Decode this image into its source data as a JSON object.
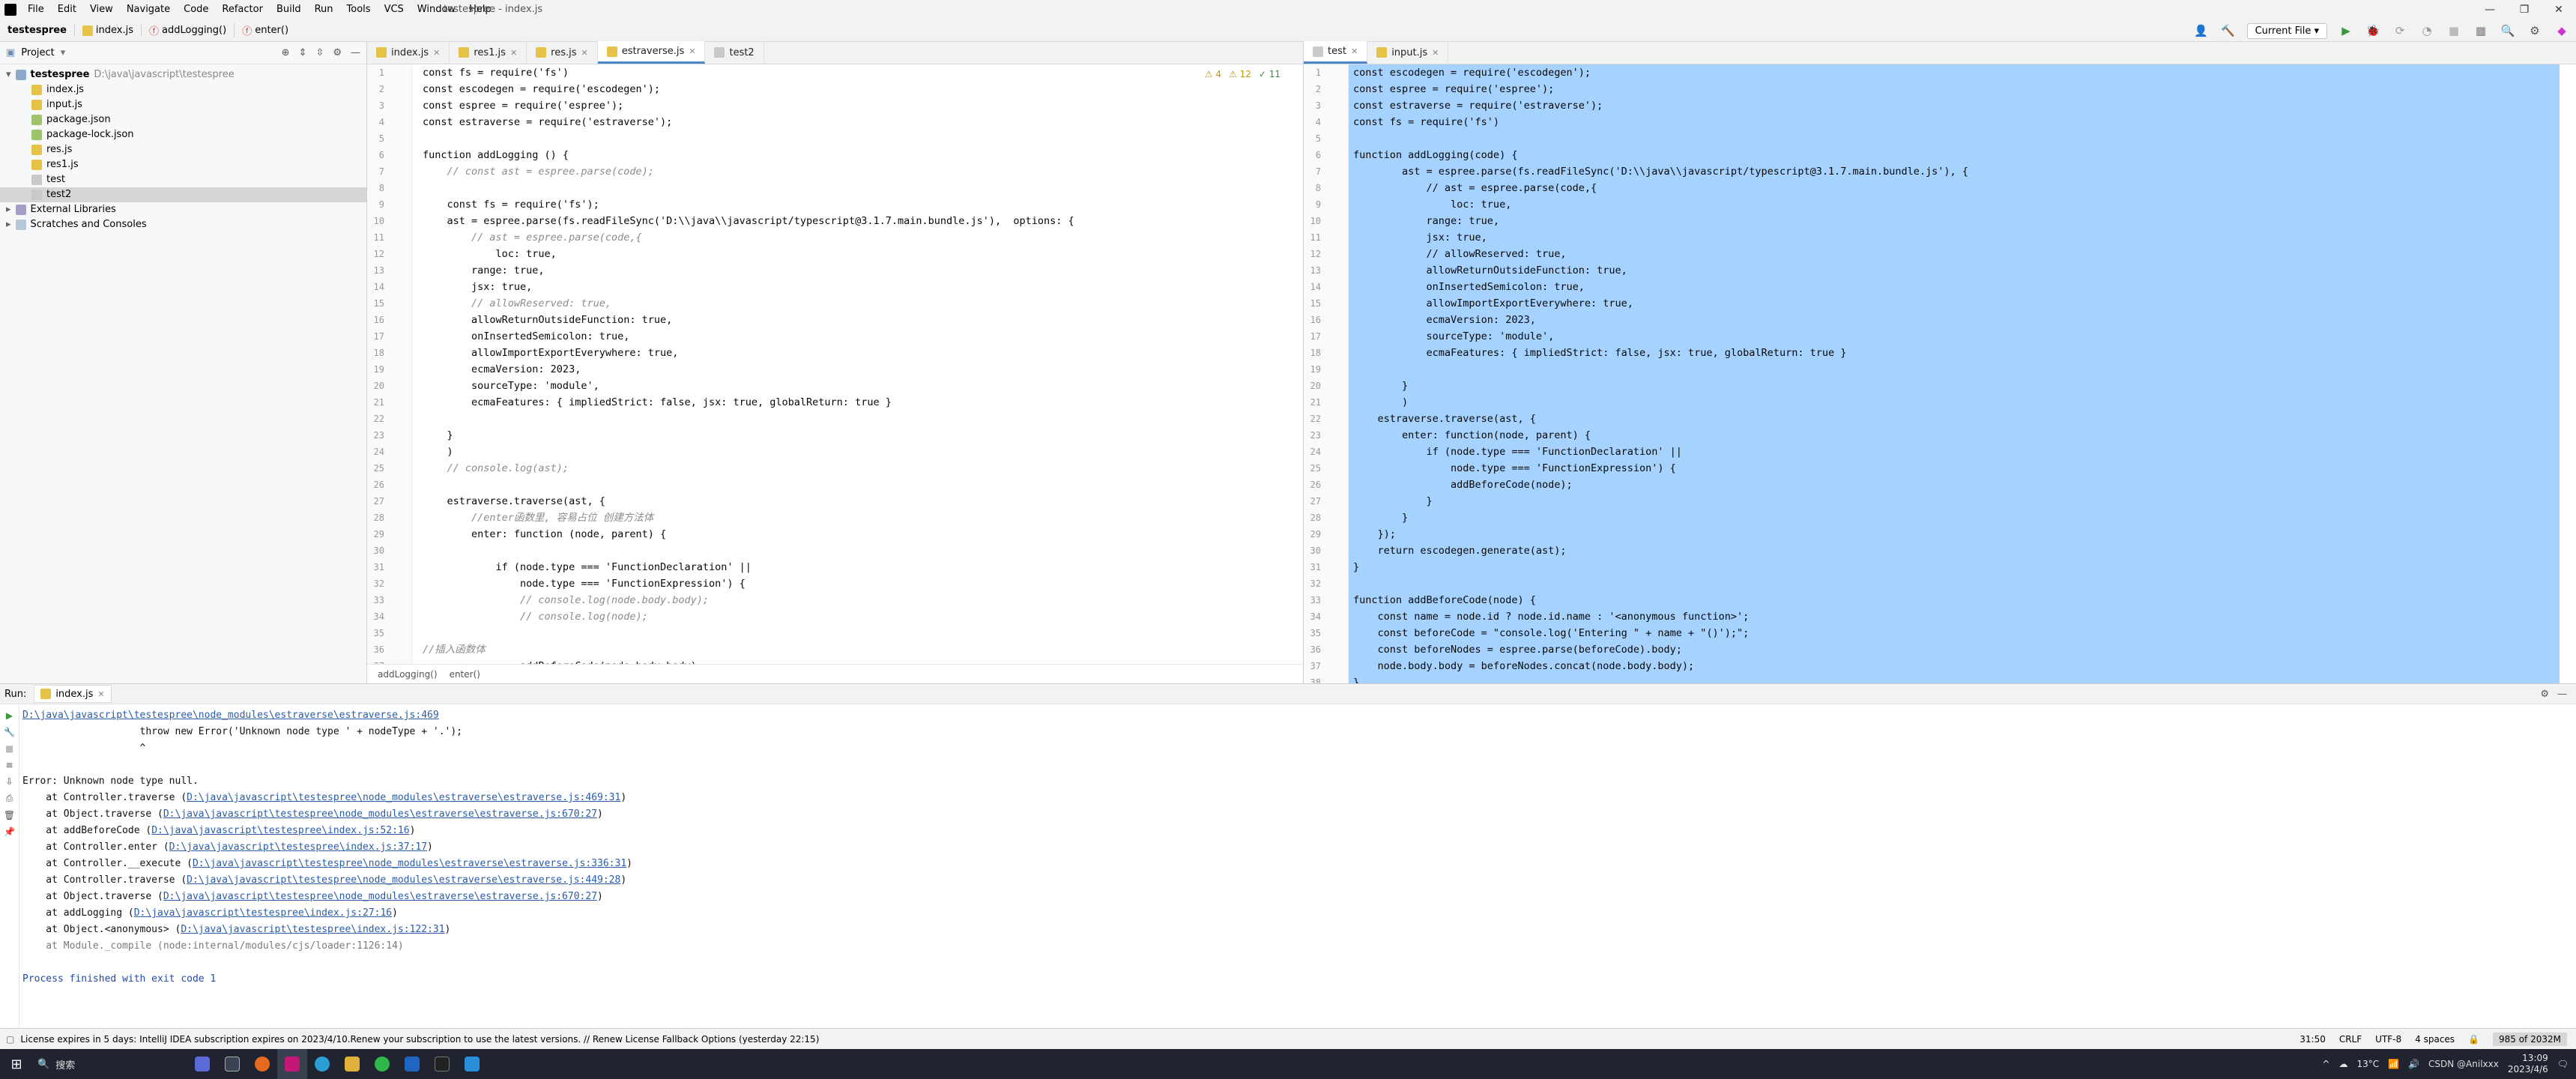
{
  "titlebar": {
    "menus": [
      "File",
      "Edit",
      "View",
      "Navigate",
      "Code",
      "Refactor",
      "Build",
      "Run",
      "Tools",
      "VCS",
      "Window",
      "Help"
    ],
    "title": "testespree - index.js",
    "win_controls": [
      "—",
      "❐",
      "✕"
    ]
  },
  "navbar": {
    "project": "testespree",
    "file": "index.js",
    "func1": "addLogging()",
    "func2": "enter()",
    "run_config": "Current File"
  },
  "project_panel": {
    "title": "Project",
    "root": "testespree",
    "root_path": "D:\\java\\javascript\\testespree",
    "files": [
      "index.js",
      "input.js",
      "package.json",
      "package-lock.json",
      "res.js",
      "res1.js",
      "test",
      "test2"
    ],
    "selected": "test2",
    "extras": [
      "External Libraries",
      "Scratches and Consoles"
    ]
  },
  "editor": {
    "tabs": [
      "index.js",
      "res1.js",
      "res.js",
      "estraverse.js",
      "test2"
    ],
    "active_tab": "estraverse.js",
    "inspections": {
      "warnings": "4",
      "weak": "12",
      "ok": "11"
    },
    "line_numbers": [
      "1",
      "2",
      "3",
      "4",
      "5",
      "6",
      "7",
      "8",
      "9",
      "10",
      "11",
      "12",
      "13",
      "14",
      "15",
      "16",
      "17",
      "18",
      "19",
      "20",
      "21",
      "22",
      "23",
      "24",
      "25",
      "26",
      "27",
      "28",
      "29",
      "30",
      "31",
      "32",
      "33",
      "34",
      "35",
      "36",
      "37"
    ],
    "lines": [
      "const fs = require('fs')",
      "const escodegen = require('escodegen');",
      "const espree = require('espree');",
      "const estraverse = require('estraverse');",
      "",
      "function addLogging () {",
      "    // const ast = espree.parse(code);",
      "",
      "    const fs = require('fs');",
      "    ast = espree.parse(fs.readFileSync('D:\\\\java\\\\javascript/typescript@3.1.7.main.bundle.js'),  options: {",
      "        // ast = espree.parse(code,{",
      "            loc: true,",
      "        range: true,",
      "        jsx: true,",
      "        // allowReserved: true,",
      "        allowReturnOutsideFunction: true,",
      "        onInsertedSemicolon: true,",
      "        allowImportExportEverywhere: true,",
      "        ecmaVersion: 2023,",
      "        sourceType: 'module',",
      "        ecmaFeatures: { impliedStrict: false, jsx: true, globalReturn: true }",
      "",
      "    }",
      "    )",
      "    // console.log(ast);",
      "",
      "    estraverse.traverse(ast, {",
      "        //enter函数里, 容易占位 创建方法体",
      "        enter: function (node, parent) {",
      "",
      "            if (node.type === 'FunctionDeclaration' ||",
      "                node.type === 'FunctionExpression') {",
      "                // console.log(node.body.body);",
      "                // console.log(node);",
      "",
      "//插入函数体",
      "                addBeforeCode(node.body.body);"
    ],
    "breadcrumbs": [
      "addLogging()",
      "enter()"
    ]
  },
  "editor2": {
    "tabs": [
      "test",
      "input.js"
    ],
    "active_tab": "test",
    "line_numbers": [
      "1",
      "2",
      "3",
      "4",
      "5",
      "6",
      "7",
      "8",
      "9",
      "10",
      "11",
      "12",
      "13",
      "14",
      "15",
      "16",
      "17",
      "18",
      "19",
      "20",
      "21",
      "22",
      "23",
      "24",
      "25",
      "26",
      "27",
      "28",
      "29",
      "30",
      "31",
      "32",
      "33",
      "34",
      "35",
      "36",
      "37",
      "38"
    ],
    "lines": [
      "const escodegen = require('escodegen');",
      "const espree = require('espree');",
      "const estraverse = require('estraverse');",
      "const fs = require('fs')",
      "",
      "function addLogging(code) {",
      "        ast = espree.parse(fs.readFileSync('D:\\\\java\\\\javascript/typescript@3.1.7.main.bundle.js'), {",
      "            // ast = espree.parse(code,{",
      "                loc: true,",
      "            range: true,",
      "            jsx: true,",
      "            // allowReserved: true,",
      "            allowReturnOutsideFunction: true,",
      "            onInsertedSemicolon: true,",
      "            allowImportExportEverywhere: true,",
      "            ecmaVersion: 2023,",
      "            sourceType: 'module',",
      "            ecmaFeatures: { impliedStrict: false, jsx: true, globalReturn: true }",
      "",
      "        }",
      "        )",
      "    estraverse.traverse(ast, {",
      "        enter: function(node, parent) {",
      "            if (node.type === 'FunctionDeclaration' ||",
      "                node.type === 'FunctionExpression') {",
      "                addBeforeCode(node);",
      "            }",
      "        }",
      "    });",
      "    return escodegen.generate(ast);",
      "}",
      "",
      "function addBeforeCode(node) {",
      "    const name = node.id ? node.id.name : '<anonymous function>';",
      "    const beforeCode = \"console.log('Entering \" + name + \"()');\";",
      "    const beforeNodes = espree.parse(beforeCode).body;",
      "    node.body.body = beforeNodes.concat(node.body.body);",
      "}"
    ]
  },
  "run": {
    "label": "Run:",
    "tab": "index.js",
    "output": [
      {
        "t": "link",
        "text": "D:\\java\\javascript\\testespree\\node_modules\\estraverse\\estraverse.js:469"
      },
      {
        "t": "plain",
        "text": "                    throw new Error('Unknown node type ' + nodeType + '.');"
      },
      {
        "t": "plain",
        "text": "                    ^"
      },
      {
        "t": "plain",
        "text": ""
      },
      {
        "t": "plain",
        "text": "Error: Unknown node type null."
      },
      {
        "t": "trace",
        "pre": "    at Controller.traverse (",
        "link": "D:\\java\\javascript\\testespree\\node_modules\\estraverse\\estraverse.js:469:31",
        "post": ")"
      },
      {
        "t": "trace",
        "pre": "    at Object.traverse (",
        "link": "D:\\java\\javascript\\testespree\\node_modules\\estraverse\\estraverse.js:670:27",
        "post": ")"
      },
      {
        "t": "trace",
        "pre": "    at addBeforeCode (",
        "link": "D:\\java\\javascript\\testespree\\index.js:52:16",
        "post": ")"
      },
      {
        "t": "trace",
        "pre": "    at Controller.enter (",
        "link": "D:\\java\\javascript\\testespree\\index.js:37:17",
        "post": ")"
      },
      {
        "t": "trace",
        "pre": "    at Controller.__execute (",
        "link": "D:\\java\\javascript\\testespree\\node_modules\\estraverse\\estraverse.js:336:31",
        "post": ")"
      },
      {
        "t": "trace",
        "pre": "    at Controller.traverse (",
        "link": "D:\\java\\javascript\\testespree\\node_modules\\estraverse\\estraverse.js:449:28",
        "post": ")"
      },
      {
        "t": "trace",
        "pre": "    at Object.traverse (",
        "link": "D:\\java\\javascript\\testespree\\node_modules\\estraverse\\estraverse.js:670:27",
        "post": ")"
      },
      {
        "t": "trace",
        "pre": "    at addLogging (",
        "link": "D:\\java\\javascript\\testespree\\index.js:27:16",
        "post": ")"
      },
      {
        "t": "trace",
        "pre": "    at Object.<anonymous> (",
        "link": "D:\\java\\javascript\\testespree\\index.js:122:31",
        "post": ")"
      },
      {
        "t": "gray",
        "text": "    at Module._compile (node:internal/modules/cjs/loader:1126:14)"
      },
      {
        "t": "plain",
        "text": ""
      },
      {
        "t": "blue",
        "text": "Process finished with exit code 1"
      }
    ]
  },
  "statusbar": {
    "message": "License expires in 5 days: IntelliJ IDEA subscription expires on 2023/4/10.Renew your subscription to use the latest versions. // Renew License    Fallback Options (yesterday 22:15)",
    "position": "31:50",
    "line_sep": "CRLF",
    "encoding": "UTF-8",
    "indent": "4 spaces",
    "memory": "985 of 2032M"
  },
  "taskbar": {
    "search": "搜索",
    "weather": "13°C",
    "time": "13:09",
    "date": "2023/4/6",
    "watermark": "CSDN @Anilxxx"
  }
}
